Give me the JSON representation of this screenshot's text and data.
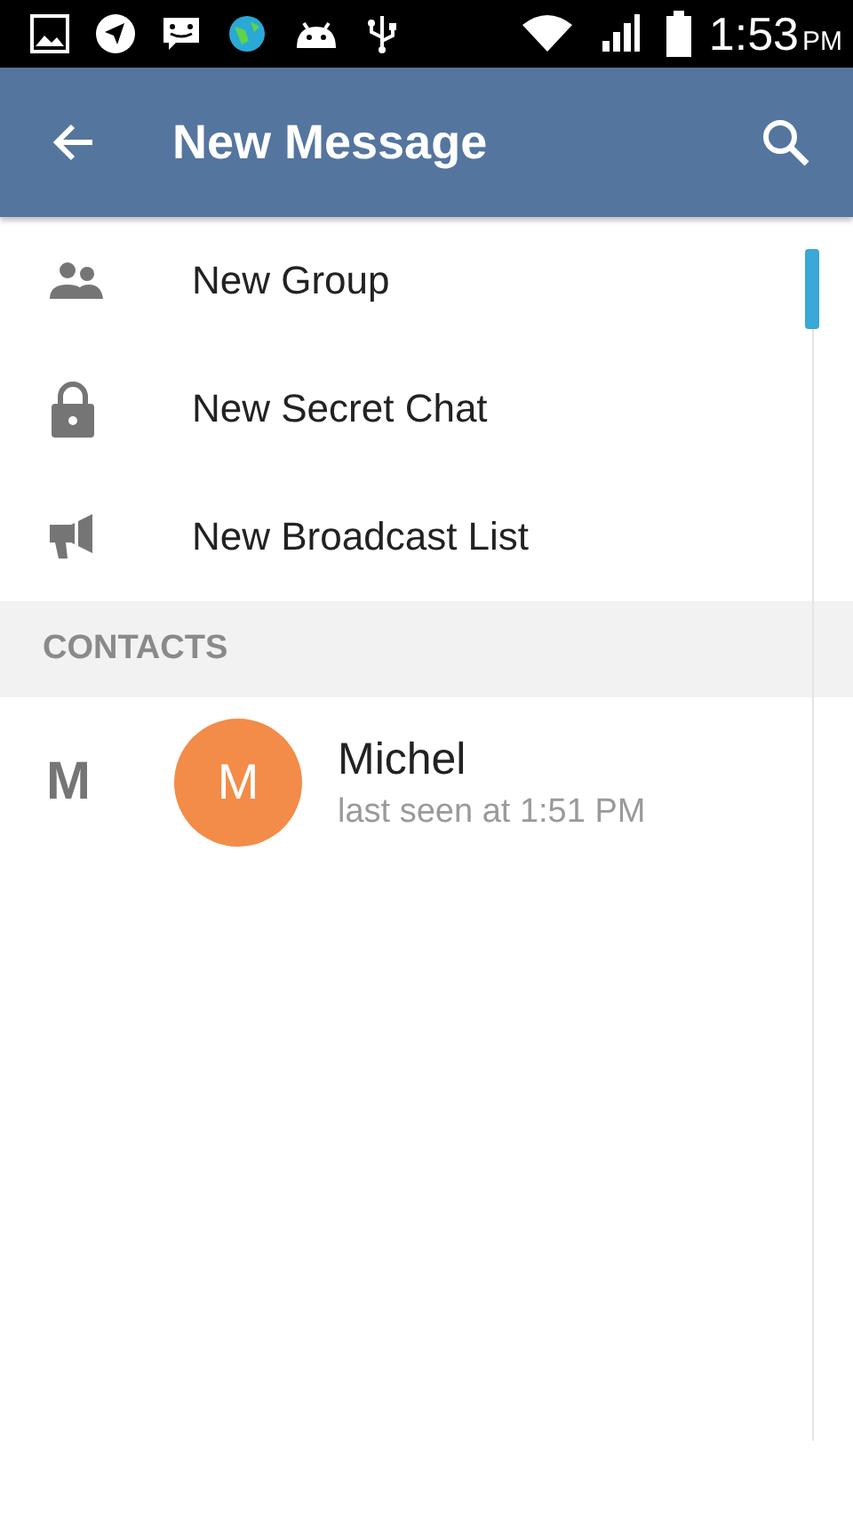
{
  "status_bar": {
    "icons": [
      {
        "kind": "gallery"
      },
      {
        "kind": "navigation"
      },
      {
        "kind": "chat"
      },
      {
        "kind": "globe"
      },
      {
        "kind": "android"
      },
      {
        "kind": "usb"
      }
    ],
    "right_icons": [
      {
        "kind": "wifi"
      },
      {
        "kind": "signal"
      },
      {
        "kind": "battery"
      }
    ],
    "time": "1:53",
    "period": "PM"
  },
  "app_bar": {
    "title": "New Message"
  },
  "menu_items": [
    {
      "kind": "group",
      "label": "New Group"
    },
    {
      "kind": "lock",
      "label": "New Secret Chat"
    },
    {
      "kind": "broadcast",
      "label": "New Broadcast List"
    }
  ],
  "section": {
    "title": "CONTACTS"
  },
  "contacts": [
    {
      "index_letter": "M",
      "initial": "M",
      "name": "Michel",
      "status": "last seen at 1:51 PM",
      "color": "#f28c48"
    }
  ]
}
